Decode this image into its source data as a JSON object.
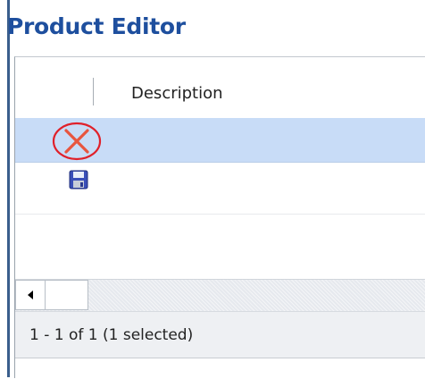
{
  "editor": {
    "title": "Product Editor"
  },
  "grid": {
    "columns": [
      {
        "label": "Description"
      }
    ],
    "rows": [
      {
        "action": "delete",
        "icon": "delete-x-icon",
        "highlighted": true,
        "circled": true
      },
      {
        "action": "save",
        "icon": "save-disk-icon",
        "highlighted": false
      }
    ],
    "selected_row_color": "#c8dcf7"
  },
  "pager": {
    "status": "1 - 1 of 1 (1 selected)"
  },
  "colors": {
    "title": "#1e4f9e",
    "delete_x": "#e8553e",
    "annotation_circle": "#e0202a"
  }
}
